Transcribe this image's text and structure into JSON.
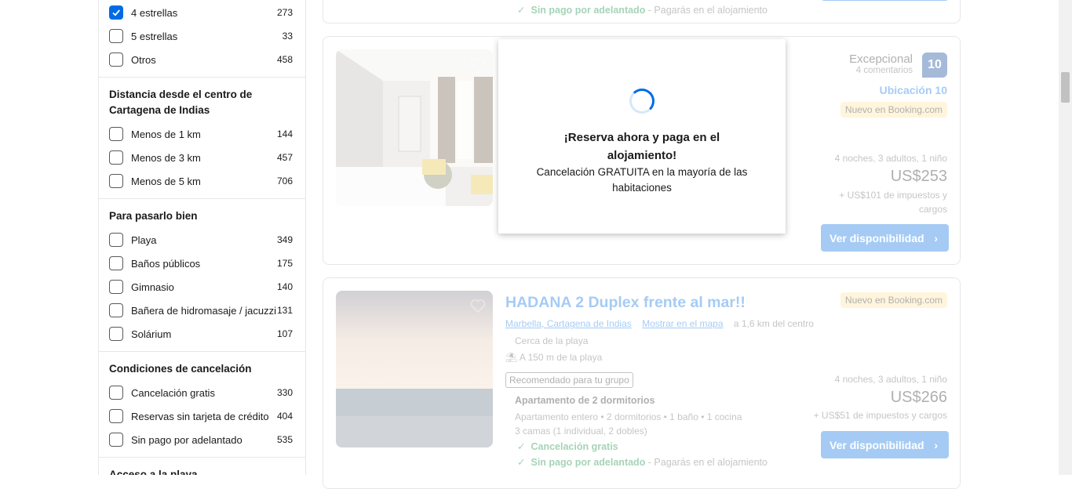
{
  "filters": {
    "stars": [
      {
        "label": "4 estrellas",
        "count": "273",
        "checked": true
      },
      {
        "label": "5 estrellas",
        "count": "33",
        "checked": false
      },
      {
        "label": "Otros",
        "count": "458",
        "checked": false
      }
    ],
    "distance": {
      "title": "Distancia desde el centro de Cartagena de Indias",
      "items": [
        {
          "label": "Menos de 1 km",
          "count": "144"
        },
        {
          "label": "Menos de 3 km",
          "count": "457"
        },
        {
          "label": "Menos de 5 km",
          "count": "706"
        }
      ]
    },
    "fun": {
      "title": "Para pasarlo bien",
      "items": [
        {
          "label": "Playa",
          "count": "349"
        },
        {
          "label": "Baños públicos",
          "count": "175"
        },
        {
          "label": "Gimnasio",
          "count": "140"
        },
        {
          "label": "Bañera de hidromasaje / jacuzzi",
          "count": "131"
        },
        {
          "label": "Solárium",
          "count": "107"
        }
      ]
    },
    "cancel": {
      "title": "Condiciones de cancelación",
      "items": [
        {
          "label": "Cancelación gratis",
          "count": "330"
        },
        {
          "label": "Reservas sin tarjeta de crédito",
          "count": "404"
        },
        {
          "label": "Sin pago por adelantado",
          "count": "535"
        }
      ]
    },
    "next_title": "Acceso a la playa"
  },
  "card_top": {
    "no_prepay": "Sin pago por adelantado",
    "no_prepay_note": " - Pagarás en el alojamiento"
  },
  "card1": {
    "rating_word": "Excepcional",
    "reviews": "4 comentarios",
    "score": "10",
    "location_score": "Ubicación 10",
    "new_badge": "Nuevo en Booking.com",
    "stay": "4 noches, 3 adultos, 1 niño",
    "price": "US$253",
    "taxes": "+ US$101 de impuestos y cargos",
    "button": "Ver disponibilidad"
  },
  "card2": {
    "title": "HADANA 2 Duplex frente al mar!!",
    "location": "Marbella, Cartagena de Indias",
    "map_link": "Mostrar en el mapa",
    "distance": "a 1,6 km del centro",
    "near_beach": "Cerca de la playa",
    "beach_dist": "A 150 m de la playa",
    "recommended": "Recomendado para tu grupo",
    "unit_title": "Apartamento de 2 dormitorios",
    "unit_desc": "Apartamento entero • 2 dormitorios • 1 baño • 1 cocina",
    "beds": "3 camas (1 individual, 2 dobles)",
    "free_cancel": "Cancelación gratis",
    "no_prepay": "Sin pago por adelantado",
    "no_prepay_note": " - Pagarás en el alojamiento",
    "new_badge": "Nuevo en Booking.com",
    "stay": "4 noches, 3 adultos, 1 niño",
    "price": "US$266",
    "taxes": "+ US$51 de impuestos y cargos",
    "button": "Ver disponibilidad"
  },
  "overlay": {
    "title": "¡Reserva ahora y paga en el alojamiento!",
    "subtitle": "Cancelación GRATUITA en la mayoría de las habitaciones"
  },
  "colors": {
    "accent": "#006ce4",
    "green": "#008234",
    "badge": "#ffe49c"
  }
}
